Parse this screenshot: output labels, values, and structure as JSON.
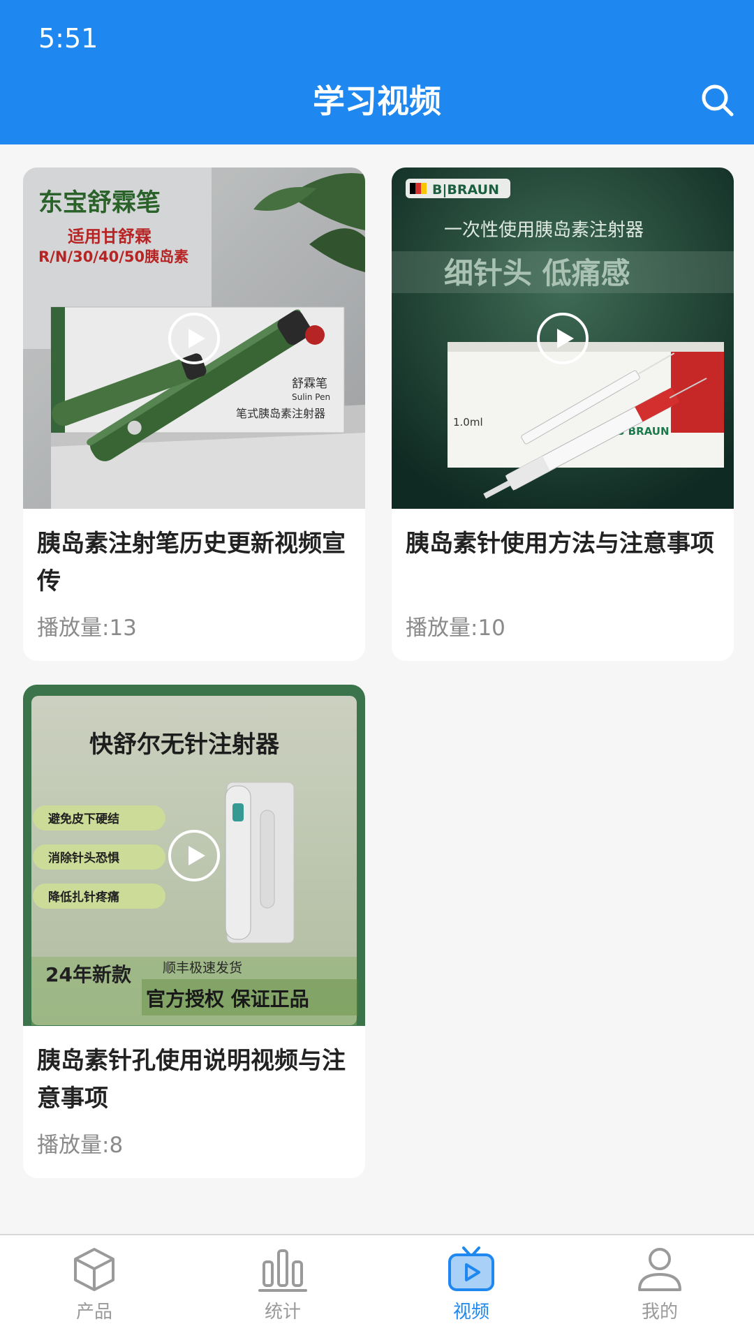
{
  "status_bar": {
    "time": "5:51"
  },
  "header": {
    "title": "学习视频",
    "search_icon": "search-icon"
  },
  "videos": [
    {
      "title": "胰岛素注射笔历史更新视频宣传",
      "views": "播放量:13",
      "thumbnail_text": {
        "brand": "东宝舒霖笔",
        "line1": "适用甘舒霖",
        "line2": "R/N/30/40/50胰岛素",
        "pack_name": "舒霖笔",
        "pack_en": "Sulin Pen",
        "pack_desc": "笔式胰岛素注射器"
      }
    },
    {
      "title": "胰岛素针使用方法与注意事项",
      "views": "播放量:10",
      "thumbnail_text": {
        "brand": "B|BRAUN",
        "line1": "一次性使用胰岛素注射器",
        "line2": "细针头  低痛感",
        "volume": "1.0ml",
        "box_brand": "B BRAUN"
      }
    },
    {
      "title": "胰岛素针孔使用说明视频与注意事项",
      "views": "播放量:8",
      "thumbnail_text": {
        "headline": "快舒尔无针注射器",
        "benefit1": "避免皮下硬结",
        "benefit2": "消除针头恐惧",
        "benefit3": "降低扎针疼痛",
        "badge": "24年新款",
        "shipping": "顺丰极速发货",
        "official": "官方授权 保证正品"
      }
    }
  ],
  "tabbar": {
    "tabs": [
      {
        "label": "产品",
        "icon": "cube-icon",
        "active": false
      },
      {
        "label": "统计",
        "icon": "bar-chart-icon",
        "active": false
      },
      {
        "label": "视频",
        "icon": "tv-play-icon",
        "active": true
      },
      {
        "label": "我的",
        "icon": "user-icon",
        "active": false
      }
    ]
  },
  "colors": {
    "primary": "#1e88f0",
    "background": "#f6f6f6",
    "inactive": "#9a9a9a"
  }
}
